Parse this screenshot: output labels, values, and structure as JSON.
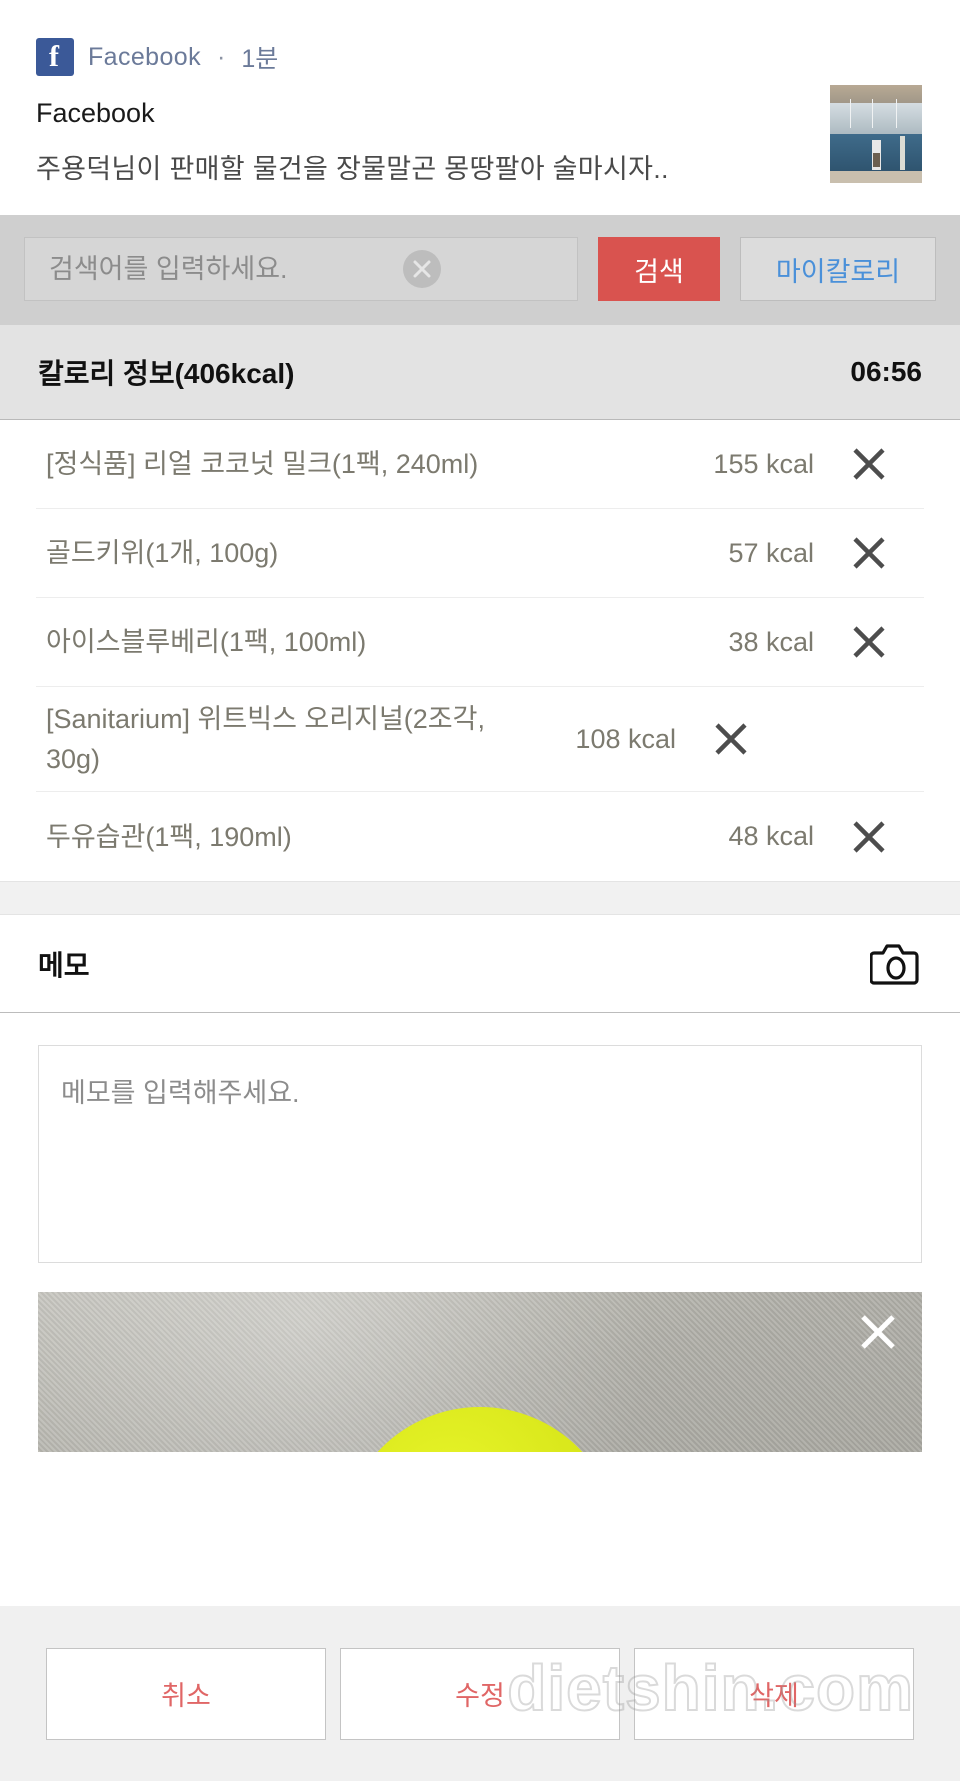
{
  "notification": {
    "app_name": "Facebook",
    "separator": "·",
    "time_ago": "1분",
    "title": "Facebook",
    "body": "주용덕님이 판매할 물건을 장물말곤 몽땅팔아 술마시자..",
    "logo_letter": "f",
    "thumbnail_alt": "harbor-photo"
  },
  "search": {
    "placeholder": "검색어를 입력하세요.",
    "value": "",
    "clear_icon": "clear-circle-icon",
    "search_label": "검색",
    "mycalorie_label": "마이칼로리",
    "search_button_color": "#d9534f",
    "mycalorie_text_color": "#4a90d9"
  },
  "calorie_section": {
    "title": "칼로리 정보(406kcal)",
    "total_kcal": 406,
    "time": "06:56",
    "items": [
      {
        "name": "[정식품] 리얼 코코넛 밀크(1팩, 240ml)",
        "kcal": "155 kcal",
        "delete_icon": "close-x-icon"
      },
      {
        "name": "골드키위(1개, 100g)",
        "kcal": "57 kcal",
        "delete_icon": "close-x-icon"
      },
      {
        "name": "아이스블루베리(1팩, 100ml)",
        "kcal": "38 kcal",
        "delete_icon": "close-x-icon"
      },
      {
        "name": "[Sanitarium] 위트빅스 오리지널(2조각, 30g)",
        "kcal": "108 kcal",
        "delete_icon": "close-x-icon"
      },
      {
        "name": "두유습관(1팩, 190ml)",
        "kcal": "48 kcal",
        "delete_icon": "close-x-icon"
      }
    ]
  },
  "memo": {
    "label": "메모",
    "camera_icon": "camera-icon",
    "placeholder": "메모를 입력해주세요.",
    "value": ""
  },
  "photo": {
    "close_icon": "close-x-icon",
    "alt": "food-photo-yellow-cap"
  },
  "watermark": {
    "text": "dietshin.com"
  },
  "actions": {
    "cancel_label": "취소",
    "edit_label": "수정",
    "delete_label": "삭제",
    "text_color": "#e06666"
  }
}
